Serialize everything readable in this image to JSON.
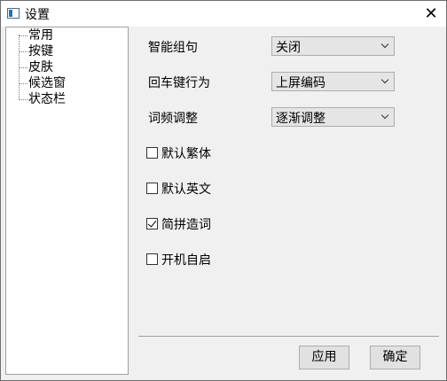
{
  "window": {
    "title": "设置",
    "close_glyph": "✕"
  },
  "tree": {
    "items": [
      "常用",
      "按键",
      "皮肤",
      "候选窗",
      "状态栏"
    ]
  },
  "settings": {
    "smart_group_label": "智能组句",
    "smart_group_value": "关闭",
    "enter_key_label": "回车键行为",
    "enter_key_value": "上屏编码",
    "frequency_label": "词频调整",
    "frequency_value": "逐渐调整"
  },
  "checkboxes": [
    {
      "label": "默认繁体",
      "checked": false
    },
    {
      "label": "默认英文",
      "checked": false
    },
    {
      "label": "简拼造词",
      "checked": true
    },
    {
      "label": "开机自启",
      "checked": false
    }
  ],
  "buttons": {
    "apply": "应用",
    "ok": "确定"
  },
  "icons": {
    "app": "settings-app-icon",
    "close": "close-icon",
    "dropdown": "chevron-down-icon"
  }
}
